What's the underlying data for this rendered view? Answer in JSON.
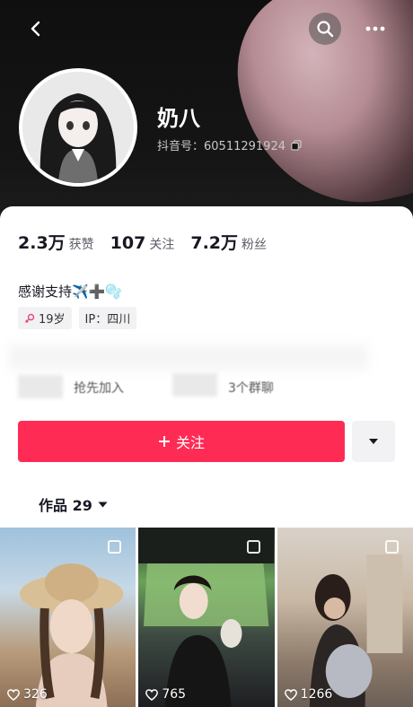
{
  "header": {
    "username": "奶八",
    "douyin_id": "抖音号：60511291924"
  },
  "stats": [
    {
      "value": "2.3万",
      "label": "获赞"
    },
    {
      "value": "107",
      "label": "关注"
    },
    {
      "value": "7.2万",
      "label": "粉丝"
    }
  ],
  "bio": "感谢支持✈️➕🫧",
  "tags": {
    "age": "19岁",
    "ip": "IP：四川"
  },
  "blurred_links": {
    "left": "抢先加入",
    "right": "3个群聊"
  },
  "follow_button": {
    "label": "关注",
    "color": "#fe2c55"
  },
  "works_tab": {
    "label": "作品 29"
  },
  "videos": [
    {
      "likes": "326"
    },
    {
      "likes": "765"
    },
    {
      "likes": "1266"
    }
  ]
}
